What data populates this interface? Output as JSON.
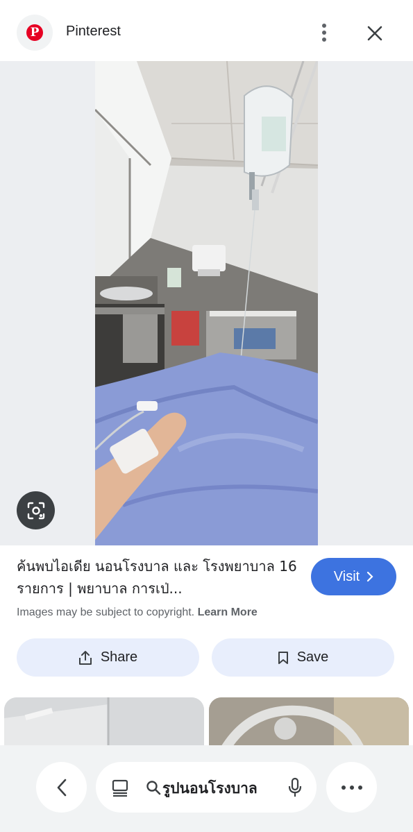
{
  "header": {
    "site_name": "Pinterest",
    "logo_letter": "P",
    "brand_color": "#e60023"
  },
  "result": {
    "title": "ค้นพบไอเดีย นอนโรงบาล และ โรงพยาบาล 16 รายการ | พยาบาล การเป่...",
    "visit_label": "Visit",
    "copyright_text": "Images may be subject to copyright.",
    "learn_more_label": "Learn More",
    "share_label": "Share",
    "save_label": "Save",
    "accent_color": "#3d73e0"
  },
  "bottom_bar": {
    "search_query": "รูปนอนโรงบาล"
  },
  "icons": [
    "pinterest-logo",
    "more-vert-icon",
    "close-icon",
    "lens-icon",
    "chevron-right-icon",
    "share-icon",
    "bookmark-icon",
    "back-icon",
    "tabs-icon",
    "search-icon",
    "mic-icon",
    "more-horiz-icon"
  ]
}
